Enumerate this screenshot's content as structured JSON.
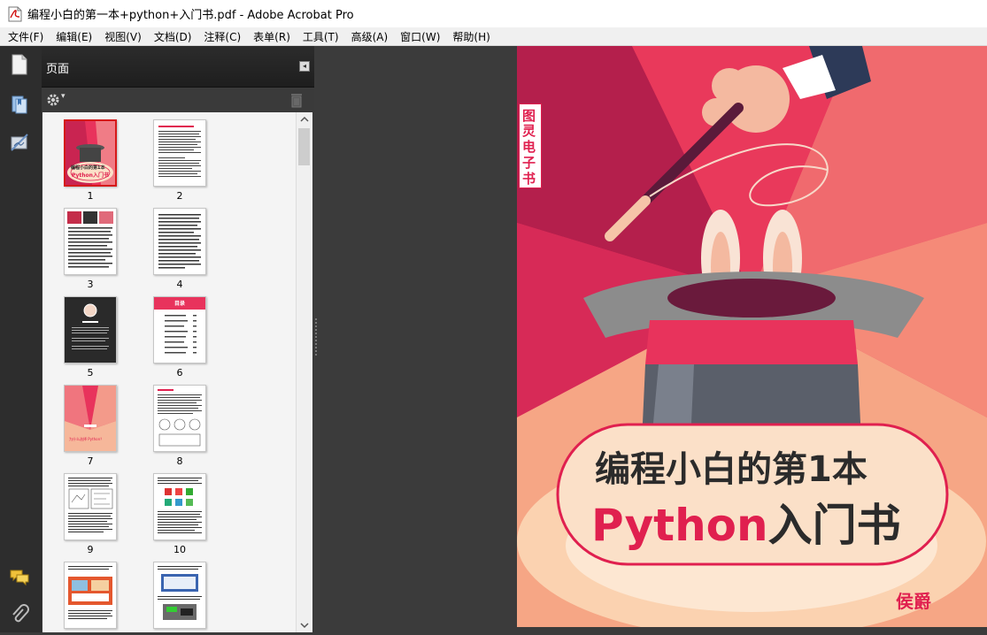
{
  "window": {
    "title": "编程小白的第一本+python+入门书.pdf - Adobe Acrobat Pro"
  },
  "menu": [
    "文件(F)",
    "编辑(E)",
    "视图(V)",
    "文档(D)",
    "注释(C)",
    "表单(R)",
    "工具(T)",
    "高级(A)",
    "窗口(W)",
    "帮助(H)"
  ],
  "panel": {
    "title": "页面",
    "collapse_glyph": "◂",
    "options_glyph": "▾"
  },
  "thumbnails": [
    {
      "num": "1",
      "selected": true,
      "style": "cover"
    },
    {
      "num": "2",
      "style": "text"
    },
    {
      "num": "3",
      "style": "images-text"
    },
    {
      "num": "4",
      "style": "text"
    },
    {
      "num": "5",
      "style": "dark"
    },
    {
      "num": "6",
      "style": "toc"
    },
    {
      "num": "7",
      "style": "chapter"
    },
    {
      "num": "8",
      "style": "text-figure"
    },
    {
      "num": "9",
      "style": "text-figure"
    },
    {
      "num": "10",
      "style": "icons"
    },
    {
      "num": "",
      "style": "photos"
    },
    {
      "num": "",
      "style": "screens"
    }
  ],
  "thumb_text": {
    "cover_line1": "编程小白的第1本",
    "cover_line2": "Python入门书",
    "toc_heading": "目录",
    "chapter_text": "为什么选择 Python？"
  },
  "cover": {
    "side_label": [
      "图",
      "灵",
      "电",
      "子",
      "书"
    ],
    "title_line1": "编程小白的第1本",
    "title_python": "Python",
    "title_rest": "入门书",
    "author": "侯爵"
  },
  "colors": {
    "cover_pink": "#e8335c",
    "accent_red": "#e0204f",
    "selection_red": "#d51a1a"
  }
}
